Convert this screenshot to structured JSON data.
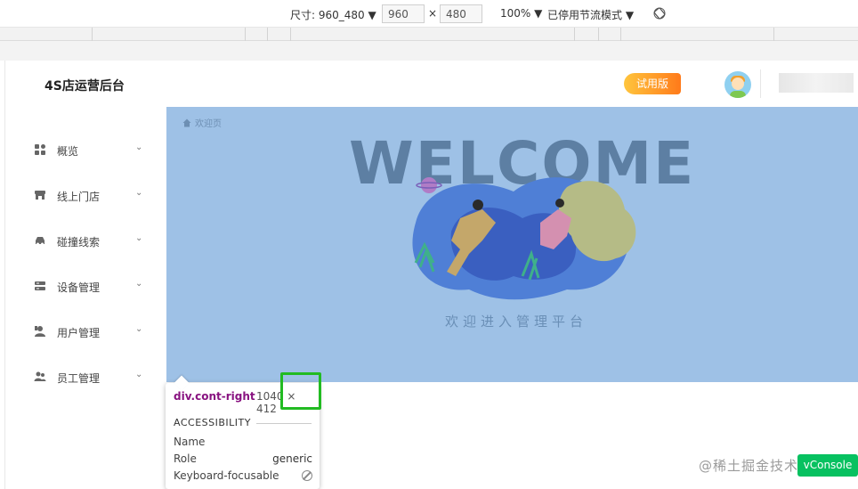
{
  "devtools": {
    "size_label": "尺寸: 960_480 ▼",
    "width": "960",
    "times": "×",
    "height": "480",
    "zoom": "100% ▼",
    "throttle": "已停用节流模式 ▼"
  },
  "header": {
    "logo": "4S店运营后台",
    "trial_badge": "试用版"
  },
  "sidebar": {
    "items": [
      {
        "label": "概览",
        "icon": "dashboard-icon"
      },
      {
        "label": "线上门店",
        "icon": "store-icon"
      },
      {
        "label": "碰撞线索",
        "icon": "car-icon"
      },
      {
        "label": "设备管理",
        "icon": "device-icon"
      },
      {
        "label": "用户管理",
        "icon": "user-manage-icon"
      },
      {
        "label": "员工管理",
        "icon": "staff-icon"
      }
    ]
  },
  "content": {
    "breadcrumb": "欢迎页",
    "welcome_title": "WELCOME",
    "welcome_subtitle": "欢迎进入管理平台",
    "background_color": "#9ec1e6"
  },
  "tooltip": {
    "selector": "div.cont-right",
    "dimensions": "1040 × 412",
    "accessibility_heading": "ACCESSIBILITY",
    "rows": [
      {
        "key": "Name",
        "value": ""
      },
      {
        "key": "Role",
        "value": "generic"
      },
      {
        "key": "Keyboard-focusable",
        "value": ""
      }
    ]
  },
  "watermark": "@稀土掘金技术社区",
  "vconsole": "vConsole"
}
